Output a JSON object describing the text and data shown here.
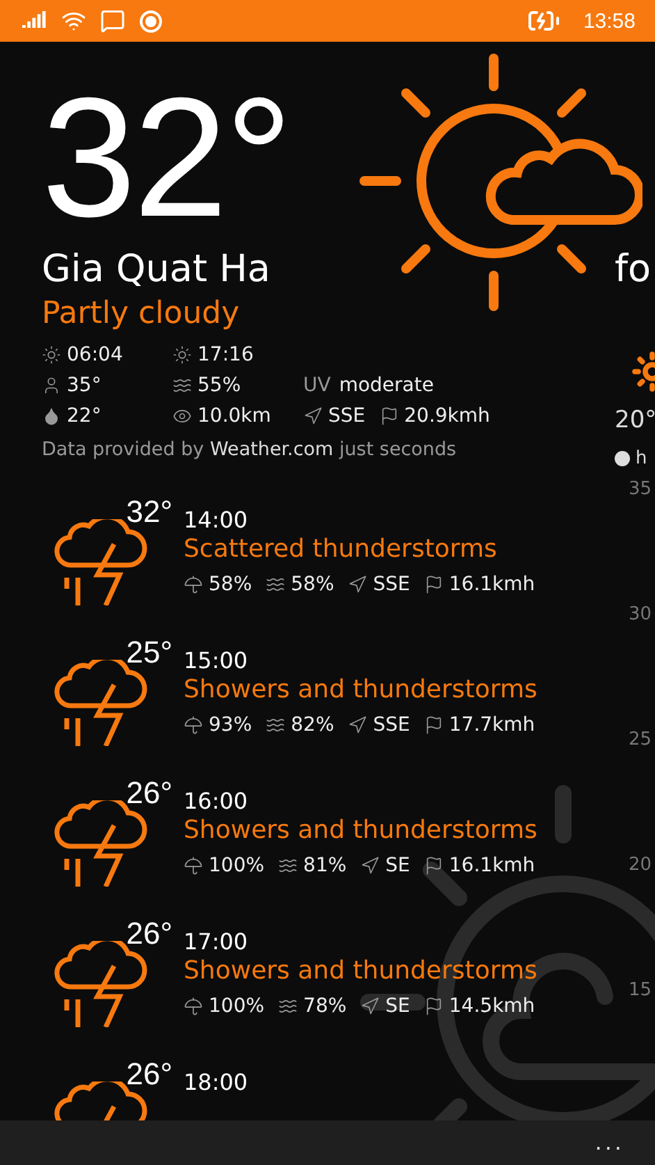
{
  "status_bar": {
    "time": "13:58"
  },
  "current": {
    "temperature": "32°",
    "location": "Gia Quat Ha",
    "condition": "Partly cloudy",
    "sunrise": "06:04",
    "sunset": "17:16",
    "feels_like": "35°",
    "humidity": "55%",
    "uv_label": "UV",
    "uv_value": "moderate",
    "dew_point": "22°",
    "visibility": "10.0km",
    "wind_direction": "SSE",
    "wind_speed": "20.9kmh"
  },
  "attribution": {
    "prefix": "Data provided by",
    "source": "Weather.com",
    "suffix": "just seconds"
  },
  "hourly": [
    {
      "temp": "32°",
      "time": "14:00",
      "condition": "Scattered thunderstorms",
      "precip": "58%",
      "humidity": "58%",
      "wind_direction": "SSE",
      "wind_speed": "16.1kmh"
    },
    {
      "temp": "25°",
      "time": "15:00",
      "condition": "Showers and thunderstorms",
      "precip": "93%",
      "humidity": "82%",
      "wind_direction": "SSE",
      "wind_speed": "17.7kmh"
    },
    {
      "temp": "26°",
      "time": "16:00",
      "condition": "Showers and thunderstorms",
      "precip": "100%",
      "humidity": "81%",
      "wind_direction": "SE",
      "wind_speed": "16.1kmh"
    },
    {
      "temp": "26°",
      "time": "17:00",
      "condition": "Showers and thunderstorms",
      "precip": "100%",
      "humidity": "78%",
      "wind_direction": "SE",
      "wind_speed": "14.5kmh"
    },
    {
      "temp": "26°",
      "time": "18:00"
    }
  ],
  "forecast_peek": {
    "title": "fo",
    "temp": "20°",
    "legend": "h",
    "axis_labels": [
      "35",
      "30",
      "25",
      "20",
      "15"
    ]
  },
  "app_bar": {
    "more": "..."
  }
}
